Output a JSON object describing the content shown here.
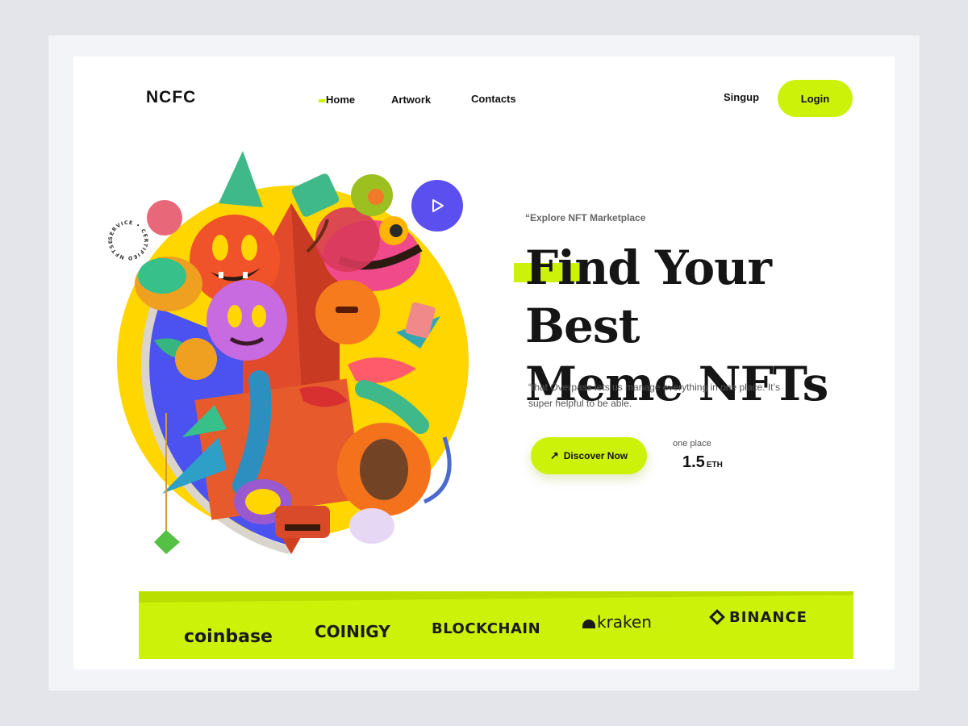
{
  "header": {
    "logo": "NCFC",
    "nav": [
      {
        "label": "Home",
        "active": true
      },
      {
        "label": "Artwork"
      },
      {
        "label": "Contacts"
      }
    ],
    "signup_label": "Singup",
    "login_label": "Login"
  },
  "hero": {
    "badge_text": "SERVICE • CERTIFIED NFTSERS",
    "eyebrow": "“Explore NFT Marketplace",
    "title_line1": "Find Your Best",
    "title_line2": "Meme NFTs",
    "description": "“that Overpass lets us manage everything in one place. It’s super helpful to be able.",
    "cta_label": "Discover Now",
    "cta_icon": "arrow-up-right-icon",
    "price_label": "one place",
    "price_value": "1.5",
    "price_unit": "ETH"
  },
  "brands": [
    "coinbase",
    "COINIGY",
    "BLOCKCHAIN",
    "kraken",
    "BINANCE"
  ],
  "colors": {
    "accent": "#cdf20a",
    "play_button": "#5b4ff0",
    "circle_yellow": "#ffd600",
    "circle_blue": "#4b52f0",
    "text": "#151515"
  }
}
